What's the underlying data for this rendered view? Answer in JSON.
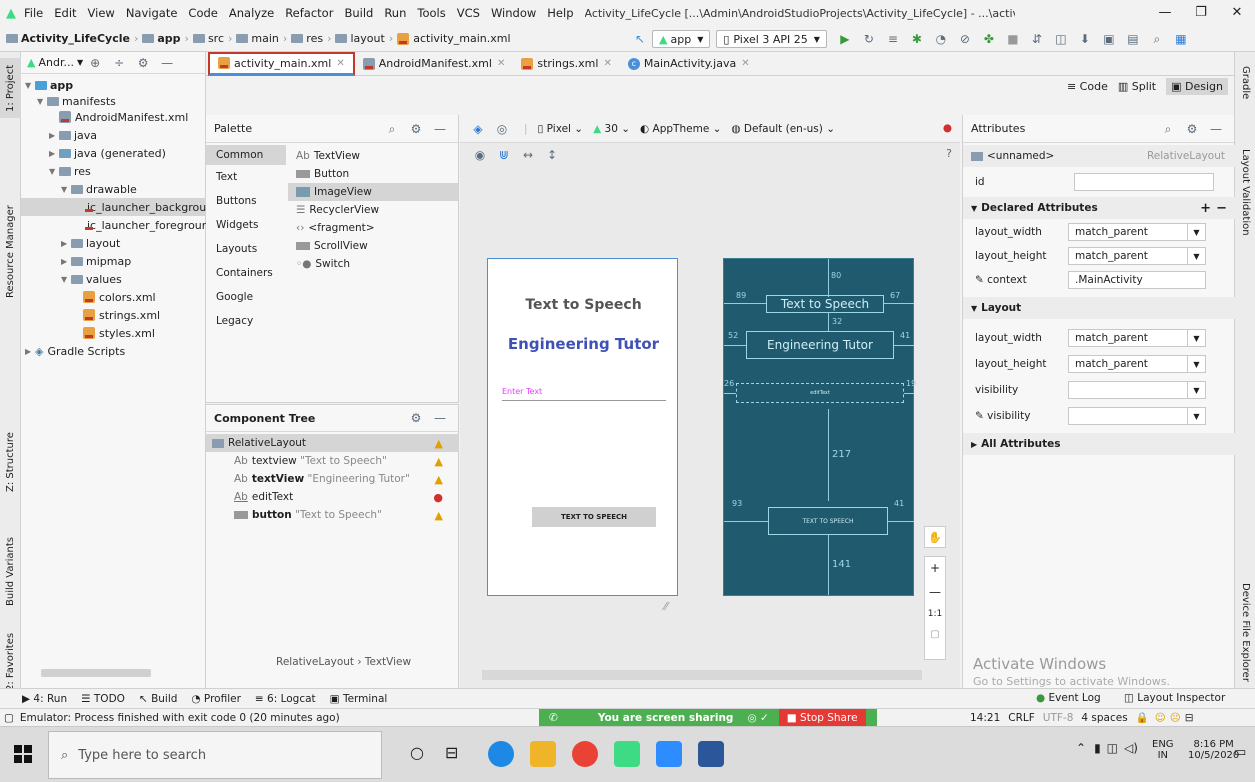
{
  "titlebar": {
    "menu": [
      "File",
      "Edit",
      "View",
      "Navigate",
      "Code",
      "Analyze",
      "Refactor",
      "Build",
      "Run",
      "Tools",
      "VCS",
      "Window",
      "Help"
    ],
    "window_title": "Activity_LifeCycle [...\\Admin\\AndroidStudioProjects\\Activity_LifeCycle] - ...\\activity_main.xml [app]"
  },
  "navbar": {
    "crumbs": [
      "Activity_LifeCycle",
      "app",
      "src",
      "main",
      "res",
      "layout",
      "activity_main.xml"
    ],
    "run_config": "app",
    "device": "Pixel 3 API 25"
  },
  "left_tabs": [
    "1: Project",
    "Resource Manager",
    "Z: Structure",
    "Build Variants",
    "2: Favorites"
  ],
  "right_tabs": [
    "Gradle",
    "Layout Validation",
    "Device File Explorer"
  ],
  "project": {
    "view_selector": "Andr...",
    "root": "app",
    "items": [
      "manifests",
      "AndroidManifest.xml",
      "java",
      "java (generated)",
      "res",
      "drawable",
      "ic_launcher_background",
      "ic_launcher_foreground",
      "layout",
      "mipmap",
      "values",
      "colors.xml",
      "strings.xml",
      "styles.xml",
      "Gradle Scripts"
    ]
  },
  "tabs": [
    "activity_main.xml",
    "AndroidManifest.xml",
    "strings.xml",
    "MainActivity.java"
  ],
  "modes": {
    "code": "Code",
    "split": "Split",
    "design": "Design"
  },
  "palette": {
    "title": "Palette",
    "categories": [
      "Common",
      "Text",
      "Buttons",
      "Widgets",
      "Layouts",
      "Containers",
      "Google",
      "Legacy"
    ],
    "items": [
      "TextView",
      "Button",
      "ImageView",
      "RecyclerView",
      "<fragment>",
      "ScrollView",
      "Switch"
    ],
    "item_prefix": "Ab"
  },
  "component_tree": {
    "title": "Component Tree",
    "root": "RelativeLayout",
    "children": [
      {
        "id": "textview",
        "text": "\"Text to Speech\""
      },
      {
        "id": "textView",
        "text": "\"Engineering Tutor\""
      },
      {
        "id": "editText",
        "text": ""
      },
      {
        "id": "button",
        "text": "\"Text to Speech\""
      }
    ],
    "breadcrumb": [
      "RelativeLayout",
      "TextView"
    ]
  },
  "device_bar": {
    "device": "Pixel",
    "api": "30",
    "theme": "AppTheme",
    "locale": "Default (en-us)"
  },
  "phone": {
    "title1": "Text to Speech",
    "title2": "Engineering Tutor",
    "hint": "Enter Text",
    "button": "TEXT TO SPEECH"
  },
  "blueprint": {
    "text1": "Text to Speech",
    "text2": "Engineering Tutor",
    "edit": "editText",
    "button": "TEXT TO SPEECH",
    "dims": [
      "80",
      "89",
      "67",
      "32",
      "52",
      "41",
      "26",
      "19",
      "217",
      "93",
      "41",
      "141"
    ]
  },
  "zoom": {
    "fit": "1:1"
  },
  "attributes": {
    "title": "Attributes",
    "component": "<unnamed>",
    "component_type": "RelativeLayout",
    "id_label": "id",
    "declared": "Declared Attributes",
    "declared_rows": [
      {
        "name": "layout_width",
        "value": "match_parent"
      },
      {
        "name": "layout_height",
        "value": "match_parent"
      },
      {
        "name": "context",
        "value": ".MainActivity"
      }
    ],
    "layout": "Layout",
    "layout_rows": [
      {
        "name": "layout_width",
        "value": "match_parent"
      },
      {
        "name": "layout_height",
        "value": "match_parent"
      },
      {
        "name": "visibility",
        "value": ""
      },
      {
        "name": "visibility",
        "value": ""
      }
    ],
    "all": "All Attributes"
  },
  "watermark": {
    "line1": "Activate Windows",
    "line2": "Go to Settings to activate Windows."
  },
  "toolwindows": [
    "4: Run",
    "TODO",
    "Build",
    "Profiler",
    "6: Logcat",
    "Terminal"
  ],
  "toolwindows_right": [
    "Event Log",
    "Layout Inspector"
  ],
  "status": {
    "message": "Emulator: Process finished with exit code 0 (20 minutes ago)",
    "sharing": "You are screen sharing",
    "stop": "Stop Share",
    "position": "14:21",
    "line_sep": "CRLF",
    "encoding": "UTF-8",
    "indent": "4 spaces"
  },
  "taskbar": {
    "search": "Type here to search",
    "lang1": "ENG",
    "lang2": "IN",
    "time": "8:16 PM",
    "date": "10/5/2020"
  },
  "colors": {
    "accent": "#3f51b5",
    "blueprint": "#1f5a6e",
    "highlight": "#c0392b",
    "hint": "#e040fb"
  }
}
